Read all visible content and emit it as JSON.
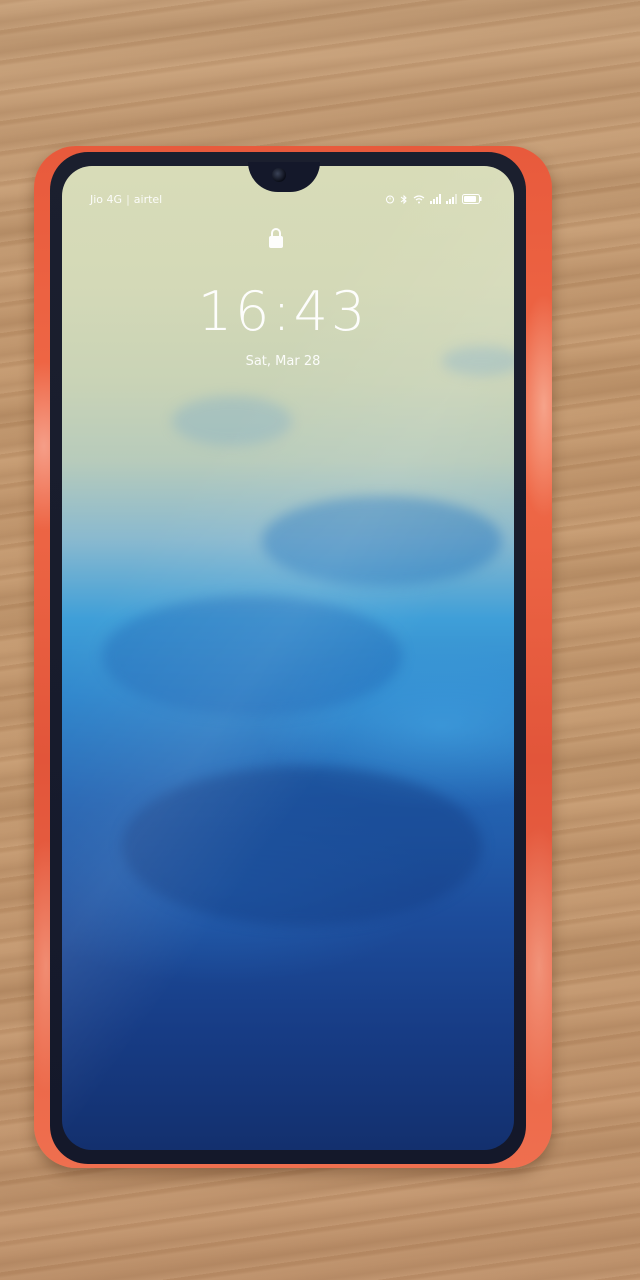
{
  "status_bar": {
    "carrier_1": "Jio 4G",
    "separator": "|",
    "carrier_2": "airtel"
  },
  "lock_screen": {
    "time": "16:43",
    "date": "Sat, Mar 28"
  },
  "icons": {
    "lock": "lock-icon",
    "alarm": "alarm-icon",
    "bluetooth": "bluetooth-icon",
    "wifi": "wifi-icon",
    "signal_1": "signal-icon",
    "signal_2": "signal-icon",
    "battery": "battery-icon"
  },
  "colors": {
    "case": "#e85a3c",
    "bezel": "#14182a",
    "sky_top": "#d8dcb8",
    "cloud_blue": "#2f86cc",
    "deep_blue": "#13306e",
    "wood": "#c59b72"
  }
}
